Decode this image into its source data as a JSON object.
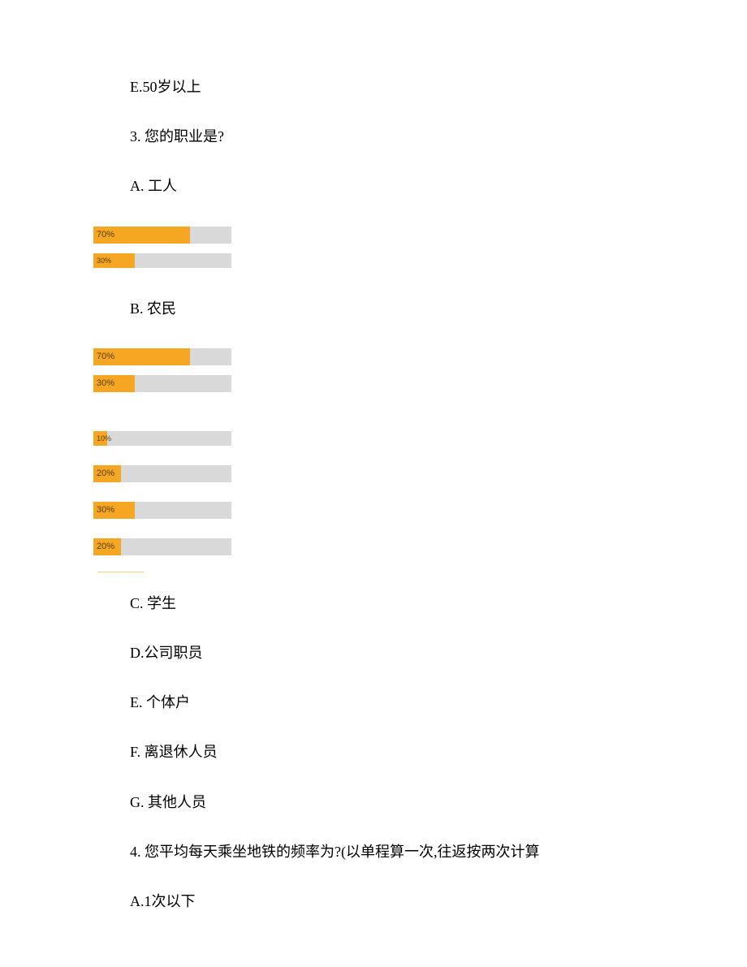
{
  "lines": {
    "e_option": "E.50岁以上",
    "q3": "3. 您的职业是?",
    "a_label": "A. 工人",
    "b_label": "B. 农民",
    "c_label": "C. 学生",
    "d_label": "D.公司职员",
    "e_label": "E. 个体户",
    "f_label": "F. 离退休人员",
    "g_label": "G. 其他人员",
    "q4": "4. 您平均每天乘坐地铁的频率为?(以单程算一次,往返按两次计算",
    "a4_label": "A.1次以下"
  },
  "chart_data": [
    {
      "type": "bar",
      "group": "A_bars",
      "max": 100,
      "bars": [
        {
          "label": "70%",
          "value": 70
        },
        {
          "label": "30%",
          "value": 30
        }
      ]
    },
    {
      "type": "bar",
      "group": "B_bars_pair",
      "max": 100,
      "bars": [
        {
          "label": "70%",
          "value": 70
        },
        {
          "label": "30%",
          "value": 30
        }
      ]
    },
    {
      "type": "bar",
      "group": "B_bars_list",
      "max": 100,
      "bars": [
        {
          "label": "10%",
          "value": 10
        },
        {
          "label": "20%",
          "value": 20
        },
        {
          "label": "30%",
          "value": 30
        },
        {
          "label": "20%",
          "value": 20
        }
      ]
    }
  ]
}
